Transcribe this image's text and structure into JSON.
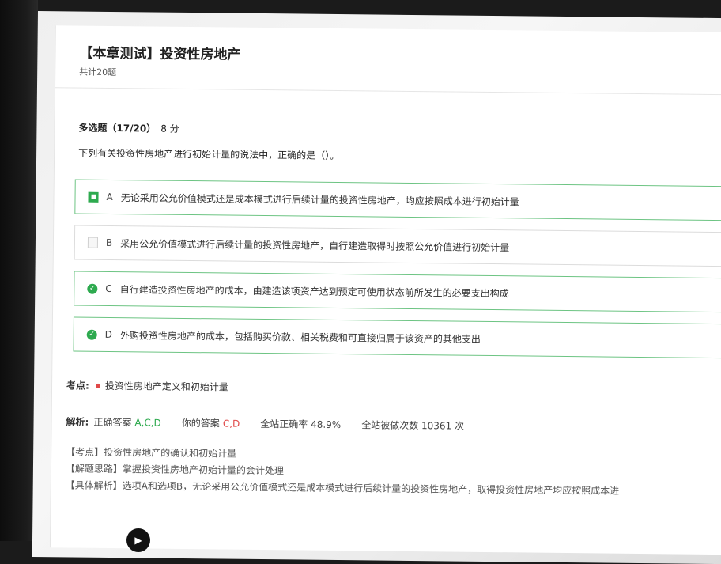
{
  "header": {
    "title": "【本章测试】投资性房地产",
    "count": "共计20题"
  },
  "question": {
    "type": "多选题（17/20）",
    "score": "8 分",
    "stem": "下列有关投资性房地产进行初始计量的说法中，正确的是（）。",
    "options": [
      {
        "letter": "A",
        "text": "无论采用公允价值模式还是成本模式进行后续计量的投资性房地产，均应按照成本进行初始计量",
        "icon": "checkbox-checked-icon"
      },
      {
        "letter": "B",
        "text": "采用公允价值模式进行后续计量的投资性房地产，自行建造取得时按照公允价值进行初始计量",
        "icon": "checkbox-empty-icon"
      },
      {
        "letter": "C",
        "text": "自行建造投资性房地产的成本，由建造该项资产达到预定可使用状态前所发生的必要支出构成",
        "icon": "check-circle-icon"
      },
      {
        "letter": "D",
        "text": "外购投资性房地产的成本，包括购买价款、相关税费和可直接归属于该资产的其他支出",
        "icon": "check-circle-icon"
      }
    ]
  },
  "knowledge_point": {
    "label": "考点:",
    "value": "投资性房地产定义和初始计量"
  },
  "analysis": {
    "label": "解析:",
    "correct_label": "正确答案",
    "correct_value": "A,C,D",
    "your_label": "你的答案",
    "your_value": "C,D",
    "accuracy": "全站正确率 48.9%",
    "attempts": "全站被做次数 10361 次",
    "details": [
      "【考点】投资性房地产的确认和初始计量",
      "【解题思路】掌握投资性房地产初始计量的会计处理",
      "【具体解析】选项A和选项B，无论采用公允价值模式还是成本模式进行后续计量的投资性房地产，取得投资性房地产均应按照成本进"
    ]
  },
  "colors": {
    "accent_green": "#2eaa4f",
    "wrong_red": "#e04848"
  }
}
